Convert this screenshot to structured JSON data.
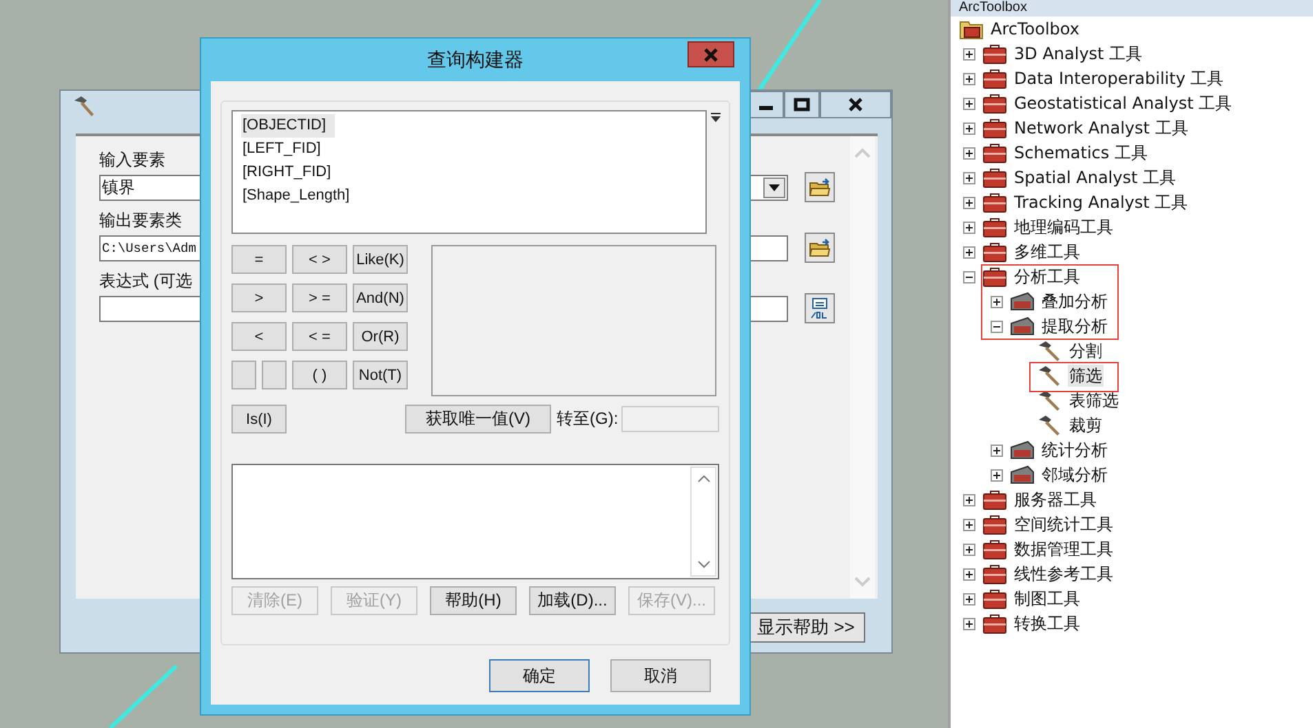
{
  "tool_dialog": {
    "fields": [
      {
        "label": "输入要素",
        "value": "镇界",
        "kind": "dropdown"
      },
      {
        "label": "输出要素类",
        "value": "C:\\Users\\Adm",
        "kind": "browse"
      },
      {
        "label": "表达式 (可选",
        "kind": "sql"
      }
    ],
    "help_button": "显示帮助 >>"
  },
  "query_builder": {
    "title": "查询构建器",
    "fields": [
      {
        "name": "[OBJECTID]",
        "selected": true
      },
      {
        "name": "[LEFT_FID]",
        "selected": false
      },
      {
        "name": "[RIGHT_FID]",
        "selected": false
      },
      {
        "name": "[Shape_Length]",
        "selected": false
      }
    ],
    "operators": [
      {
        "kind": "op",
        "label": "="
      },
      {
        "kind": "op",
        "label": "< >"
      },
      {
        "kind": "op",
        "label": "Like(K)"
      },
      {
        "kind": "op",
        "label": ">"
      },
      {
        "kind": "op",
        "label": "> ="
      },
      {
        "kind": "op",
        "label": "And(N)"
      },
      {
        "kind": "op",
        "label": "<"
      },
      {
        "kind": "op",
        "label": "< ="
      },
      {
        "kind": "op",
        "label": "Or(R)"
      },
      {
        "kind": "blank"
      },
      {
        "kind": "blank"
      },
      {
        "kind": "op",
        "label": "( )"
      },
      {
        "kind": "op",
        "label": "Not(T)"
      }
    ],
    "is_button": "Is(I)",
    "unique_button": "获取唯一值(V)",
    "goto_label": "转至(G):",
    "actions": [
      {
        "label": "清除(E)",
        "disabled": true
      },
      {
        "label": "验证(Y)",
        "disabled": true
      },
      {
        "label": "帮助(H)",
        "disabled": false
      },
      {
        "label": "加载(D)...",
        "disabled": false
      },
      {
        "label": "保存(V)...",
        "disabled": true
      }
    ],
    "ok": "确定",
    "cancel": "取消"
  },
  "toolbox": {
    "title": "ArcToolbox",
    "tree": [
      {
        "label": "ArcToolbox",
        "kind": "root",
        "children": [
          {
            "label": "3D Analyst 工具",
            "kind": "toolbox",
            "expanded": false
          },
          {
            "label": "Data Interoperability 工具",
            "kind": "toolbox",
            "expanded": false
          },
          {
            "label": "Geostatistical Analyst 工具",
            "kind": "toolbox",
            "expanded": false
          },
          {
            "label": "Network Analyst 工具",
            "kind": "toolbox",
            "expanded": false
          },
          {
            "label": "Schematics 工具",
            "kind": "toolbox",
            "expanded": false
          },
          {
            "label": "Spatial Analyst 工具",
            "kind": "toolbox",
            "expanded": false
          },
          {
            "label": "Tracking Analyst 工具",
            "kind": "toolbox",
            "expanded": false
          },
          {
            "label": "地理编码工具",
            "kind": "toolbox",
            "expanded": false
          },
          {
            "label": "多维工具",
            "kind": "toolbox",
            "expanded": false
          },
          {
            "label": "分析工具",
            "kind": "toolbox",
            "expanded": true,
            "children": [
              {
                "label": "叠加分析",
                "kind": "toolset",
                "expanded": false
              },
              {
                "label": "提取分析",
                "kind": "toolset",
                "expanded": true,
                "children": [
                  {
                    "label": "分割",
                    "kind": "tool",
                    "selected": false
                  },
                  {
                    "label": "筛选",
                    "kind": "tool",
                    "selected": true
                  },
                  {
                    "label": "表筛选",
                    "kind": "tool",
                    "selected": false
                  },
                  {
                    "label": "裁剪",
                    "kind": "tool",
                    "selected": false
                  }
                ]
              },
              {
                "label": "统计分析",
                "kind": "toolset",
                "expanded": false
              },
              {
                "label": "邻域分析",
                "kind": "toolset",
                "expanded": false
              }
            ]
          },
          {
            "label": "服务器工具",
            "kind": "toolbox",
            "expanded": false
          },
          {
            "label": "空间统计工具",
            "kind": "toolbox",
            "expanded": false
          },
          {
            "label": "数据管理工具",
            "kind": "toolbox",
            "expanded": false
          },
          {
            "label": "线性参考工具",
            "kind": "toolbox",
            "expanded": false
          },
          {
            "label": "制图工具",
            "kind": "toolbox",
            "expanded": false
          },
          {
            "label": "转换工具",
            "kind": "toolbox",
            "expanded": false
          }
        ]
      }
    ]
  }
}
